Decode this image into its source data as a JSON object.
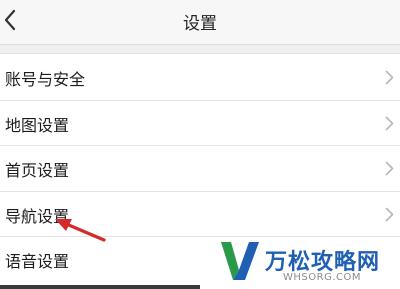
{
  "header": {
    "title": "设置",
    "back_icon": "chevron-left-icon"
  },
  "settings": {
    "items": [
      {
        "label": "账号与安全",
        "icon": "chevron-right-icon"
      },
      {
        "label": "地图设置",
        "icon": "chevron-right-icon"
      },
      {
        "label": "首页设置",
        "icon": "chevron-right-icon"
      },
      {
        "label": "导航设置",
        "icon": "chevron-right-icon"
      },
      {
        "label": "语音设置"
      }
    ]
  },
  "annotation": {
    "icon": "red-arrow-icon",
    "color": "#d42a2a"
  },
  "watermark": {
    "logo": "w-logo-icon",
    "brand": "万松攻略网",
    "site": "WHSORG.COM",
    "color": "#1f5fb4"
  }
}
